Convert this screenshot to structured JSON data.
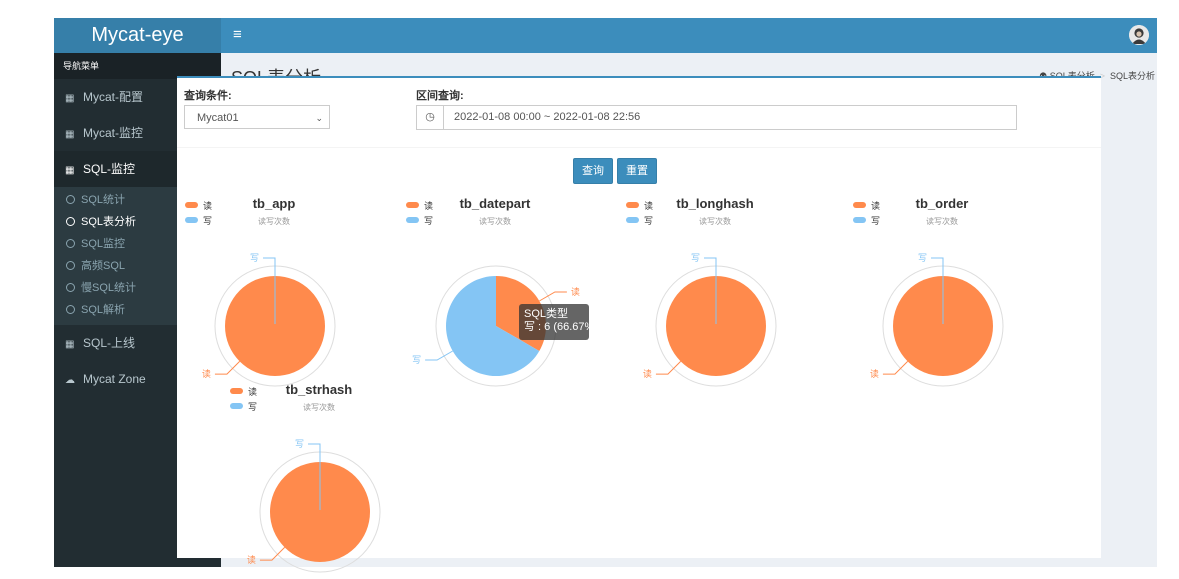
{
  "app": {
    "title": "Mycat-eye"
  },
  "topbar": {
    "menu_icon": "≡"
  },
  "sidebar": {
    "header": "导航菜单",
    "items": [
      {
        "label": "Mycat-配置"
      },
      {
        "label": "Mycat-监控"
      },
      {
        "label": "SQL-监控",
        "expanded": true
      },
      {
        "label": "SQL-上线"
      },
      {
        "label": "Mycat Zone"
      }
    ],
    "submenu": [
      {
        "label": "SQL统计"
      },
      {
        "label": "SQL表分析",
        "active": true
      },
      {
        "label": "SQL监控"
      },
      {
        "label": "高频SQL"
      },
      {
        "label": "慢SQL统计"
      },
      {
        "label": "SQL解析"
      }
    ]
  },
  "header": {
    "title": "SQL表分析",
    "breadcrumb": [
      "SQL表分析",
      "SQL表分析"
    ]
  },
  "filters": {
    "condition_label": "查询条件:",
    "condition_value": "Mycat01",
    "range_label": "区间查询:",
    "range_value": "2022-01-08 00:00 ~ 2022-01-08 22:56"
  },
  "buttons": {
    "query": "查询",
    "reset": "重置"
  },
  "colors": {
    "read": "#ff8a4c",
    "write": "#84c5f4",
    "accent": "#3c8dbc",
    "sidebar": "#222d32"
  },
  "chart_data": [
    {
      "type": "pie",
      "title": "tb_app",
      "subtitle": "读写次数",
      "legend": [
        "读",
        "写"
      ],
      "series_name": "SQL类型",
      "slices": [
        {
          "name": "读",
          "value": 1
        },
        {
          "name": "写",
          "value": 0
        }
      ]
    },
    {
      "type": "pie",
      "title": "tb_datepart",
      "subtitle": "读写次数",
      "legend": [
        "读",
        "写"
      ],
      "series_name": "SQL类型",
      "slices": [
        {
          "name": "读",
          "value": 3
        },
        {
          "name": "写",
          "value": 6
        }
      ]
    },
    {
      "type": "pie",
      "title": "tb_longhash",
      "subtitle": "读写次数",
      "legend": [
        "读",
        "写"
      ],
      "series_name": "SQL类型",
      "slices": [
        {
          "name": "读",
          "value": 1
        },
        {
          "name": "写",
          "value": 0
        }
      ]
    },
    {
      "type": "pie",
      "title": "tb_order",
      "subtitle": "读写次数",
      "legend": [
        "读",
        "写"
      ],
      "series_name": "SQL类型",
      "slices": [
        {
          "name": "读",
          "value": 1
        },
        {
          "name": "写",
          "value": 0
        }
      ]
    },
    {
      "type": "pie",
      "title": "tb_strhash",
      "subtitle": "读写次数",
      "legend": [
        "读",
        "写"
      ],
      "series_name": "SQL类型",
      "slices": [
        {
          "name": "读",
          "value": 1
        },
        {
          "name": "写",
          "value": 0
        }
      ]
    }
  ],
  "tooltip": {
    "title": "SQL类型",
    "text": "写 : 6 (66.67%)"
  }
}
